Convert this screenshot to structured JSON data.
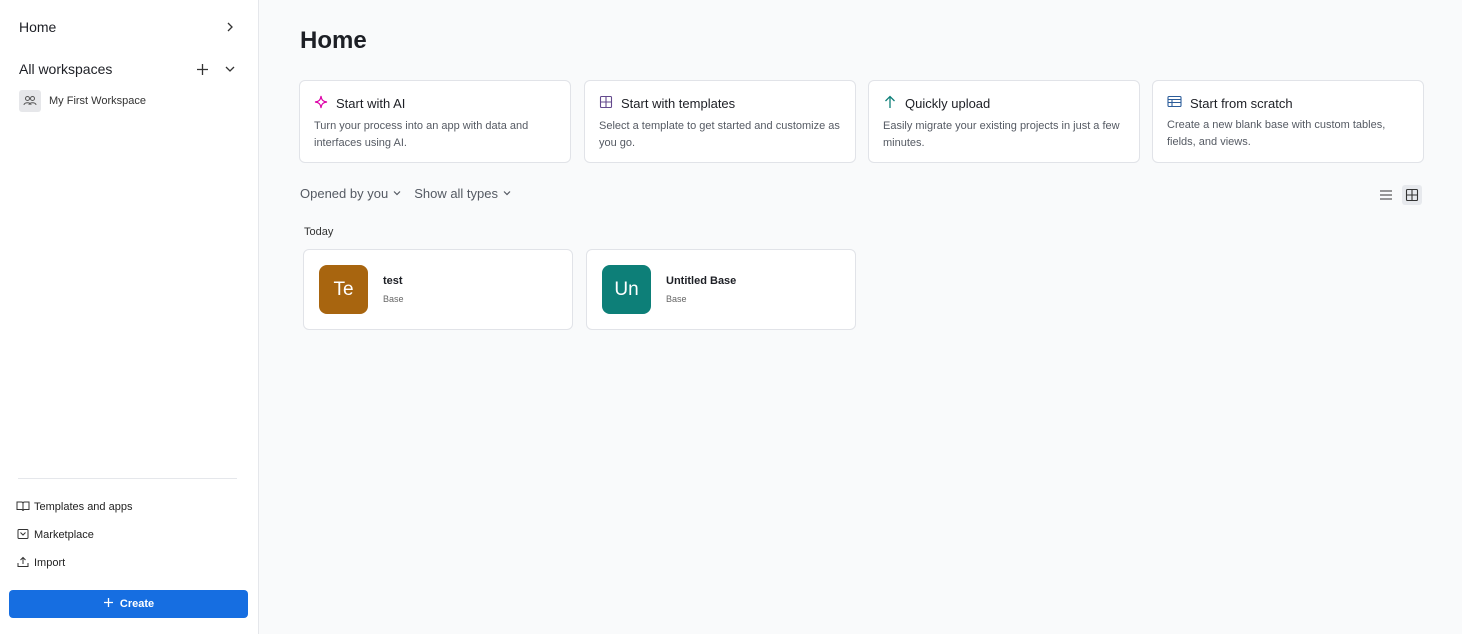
{
  "sidebar": {
    "home_label": "Home",
    "workspaces_label": "All workspaces",
    "workspace_items": [
      {
        "label": "My First Workspace",
        "icon": "people-icon"
      }
    ],
    "links": [
      {
        "label": "Templates and apps",
        "icon": "book-icon"
      },
      {
        "label": "Marketplace",
        "icon": "marketplace-icon"
      },
      {
        "label": "Import",
        "icon": "upload-icon"
      }
    ],
    "create_label": "Create"
  },
  "main": {
    "title": "Home",
    "start_cards": [
      {
        "title": "Start with AI",
        "description": "Turn your process into an app with data and interfaces using AI.",
        "icon": "sparkle-icon",
        "icon_color": "#dd04a8"
      },
      {
        "title": "Start with templates",
        "description": "Select a template to get started and customize as you go.",
        "icon": "grid-icon",
        "icon_color": "#63498d"
      },
      {
        "title": "Quickly upload",
        "description": "Easily migrate your existing projects in just a few minutes.",
        "icon": "arrow-up-icon",
        "icon_color": "#0d7f78"
      },
      {
        "title": "Start from scratch",
        "description": "Create a new blank base with custom tables, fields, and views.",
        "icon": "table-icon",
        "icon_color": "#2c5d9a"
      }
    ],
    "filters": {
      "opened_by": "Opened by you",
      "types": "Show all types"
    },
    "view_modes": {
      "list": "list-view-icon",
      "grid": "grid-view-icon",
      "active": "grid"
    },
    "section_today": "Today",
    "bases": [
      {
        "initials": "Te",
        "name": "test",
        "kind": "Base",
        "color": "#a8650f"
      },
      {
        "initials": "Un",
        "name": "Untitled Base",
        "kind": "Base",
        "color": "#0d7f78"
      }
    ]
  }
}
